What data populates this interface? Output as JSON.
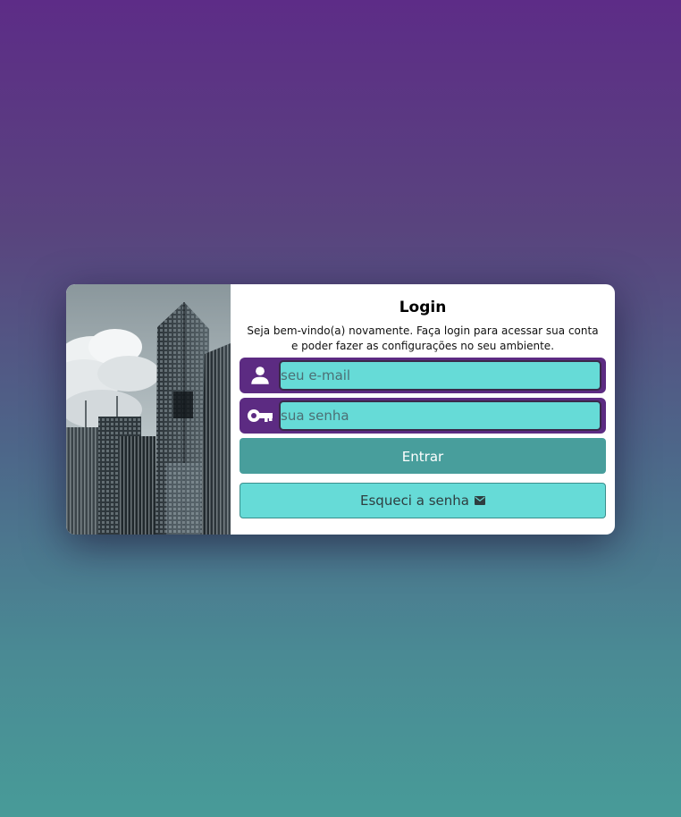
{
  "login": {
    "title": "Login",
    "subtitle": "Seja bem-vindo(a) novamente. Faça login para acessar sua conta e poder fazer as configurações no seu ambiente.",
    "email": {
      "placeholder": "seu e-mail",
      "value": "",
      "icon": "user-icon"
    },
    "password": {
      "placeholder": "sua senha",
      "value": "",
      "icon": "key-icon"
    },
    "submit_label": "Entrar",
    "forgot_label": "Esqueci a senha",
    "forgot_icon": "envelope-icon"
  },
  "colors": {
    "primary_purple": "#5c2b82",
    "accent_teal": "#66dbd7",
    "button_teal": "#489e9c"
  }
}
